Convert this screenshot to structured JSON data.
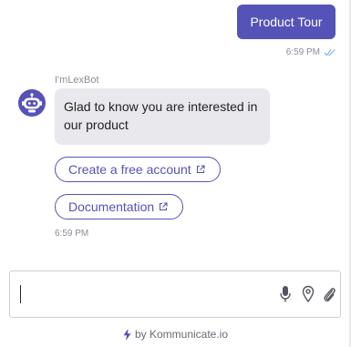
{
  "user_message": {
    "text": "Product Tour",
    "time": "6:59 PM",
    "status_icon": "double-check-icon"
  },
  "bot": {
    "name": "I'mLexBot",
    "avatar_icon": "robot-avatar-icon",
    "message": "Glad to know you are interested in our product",
    "buttons": [
      {
        "label": "Create a free account",
        "icon": "external-link-icon"
      },
      {
        "label": "Documentation",
        "icon": "external-link-icon"
      }
    ],
    "time": "6:59 PM"
  },
  "composer": {
    "value": "",
    "placeholder": "",
    "icons": [
      "microphone-icon",
      "location-pin-icon",
      "paperclip-icon"
    ]
  },
  "footer": {
    "text": "by Kommunicate.io",
    "icon": "lightning-bolt-icon"
  },
  "colors": {
    "accent": "#5553b7",
    "bot_bubble": "#e8e8ed",
    "read_receipt": "#7fb0e6"
  }
}
